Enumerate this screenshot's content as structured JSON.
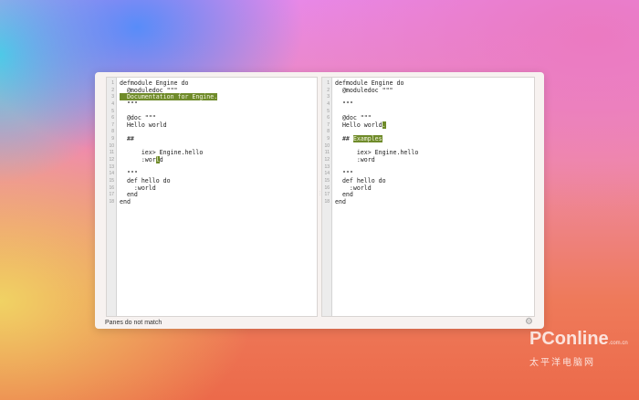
{
  "left_pane": {
    "lines": [
      [
        {
          "t": "defmodule Engine do"
        }
      ],
      [
        {
          "t": "  @moduledoc \"\"\""
        }
      ],
      [
        {
          "t": "  Documentation for Engine.",
          "hl": true
        }
      ],
      [
        {
          "t": "  \"\"\""
        }
      ],
      [
        {
          "t": ""
        }
      ],
      [
        {
          "t": "  @doc \"\"\""
        }
      ],
      [
        {
          "t": "  Hello world"
        }
      ],
      [
        {
          "t": ""
        }
      ],
      [
        {
          "t": "  ##"
        }
      ],
      [
        {
          "t": ""
        }
      ],
      [
        {
          "t": "      iex> Engine.hello"
        }
      ],
      [
        {
          "t": "      :wor"
        },
        {
          "t": "l",
          "hl": true
        },
        {
          "t": "d"
        }
      ],
      [
        {
          "t": ""
        }
      ],
      [
        {
          "t": "  \"\"\""
        }
      ],
      [
        {
          "t": "  def hello do"
        }
      ],
      [
        {
          "t": "    :world"
        }
      ],
      [
        {
          "t": "  end"
        }
      ],
      [
        {
          "t": "end"
        }
      ]
    ]
  },
  "right_pane": {
    "lines": [
      [
        {
          "t": "defmodule Engine do"
        }
      ],
      [
        {
          "t": "  @moduledoc \"\"\""
        }
      ],
      [
        {
          "t": ""
        }
      ],
      [
        {
          "t": "  \"\"\""
        }
      ],
      [
        {
          "t": ""
        }
      ],
      [
        {
          "t": "  @doc \"\"\""
        }
      ],
      [
        {
          "t": "  Hello world"
        },
        {
          "t": ".",
          "hl": true
        }
      ],
      [
        {
          "t": ""
        }
      ],
      [
        {
          "t": "  ## "
        },
        {
          "t": "Examples",
          "hl": true
        }
      ],
      [
        {
          "t": ""
        }
      ],
      [
        {
          "t": "      iex> Engine.hello"
        }
      ],
      [
        {
          "t": "      :word"
        }
      ],
      [
        {
          "t": ""
        }
      ],
      [
        {
          "t": "  \"\"\""
        }
      ],
      [
        {
          "t": "  def hello do"
        }
      ],
      [
        {
          "t": "    :world"
        }
      ],
      [
        {
          "t": "  end"
        }
      ],
      [
        {
          "t": "end"
        }
      ]
    ]
  },
  "status": {
    "text": "Panes do not match"
  },
  "watermark": {
    "brand": "PConline",
    "domain": ".com.cn",
    "cn": "太平洋电脑网"
  },
  "colors": {
    "highlight": "#6f8b2a"
  }
}
